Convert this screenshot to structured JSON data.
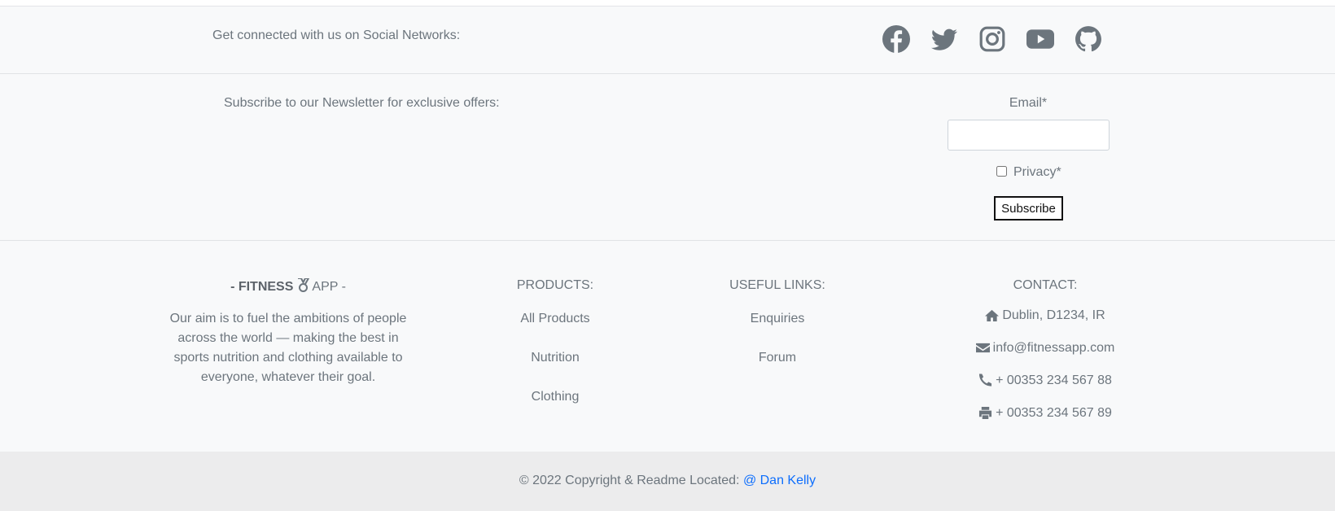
{
  "social": {
    "text": "Get connected with us on Social Networks:",
    "icons": [
      "facebook-icon",
      "twitter-icon",
      "instagram-icon",
      "youtube-icon",
      "github-icon"
    ]
  },
  "newsletter": {
    "text": "Subscribe to our Newsletter for exclusive offers:",
    "email_label": "Email*",
    "email_value": "",
    "privacy_label": "Privacy*",
    "privacy_checked": false,
    "subscribe_label": "Subscribe"
  },
  "brand": {
    "title_left": "- FITNESS",
    "title_icon": "medal-icon",
    "title_right": "APP -",
    "description": "Our aim is to fuel the ambitions of people across the world — making the best in sports nutrition and clothing available to everyone, whatever their goal."
  },
  "products": {
    "heading": "PRODUCTS:",
    "items": [
      "All Products",
      "Nutrition",
      "Clothing"
    ]
  },
  "useful_links": {
    "heading": "USEFUL LINKS:",
    "items": [
      "Enquiries",
      "Forum"
    ]
  },
  "contact": {
    "heading": "CONTACT:",
    "address": "Dublin, D1234, IR",
    "email": "info@fitnessapp.com",
    "phone": "+ 00353 234 567 88",
    "fax": "+ 00353 234 567 89"
  },
  "copyright": {
    "text": "© 2022 Copyright & Readme Located: ",
    "link_label": "@ Dan Kelly"
  },
  "colors": {
    "text": "#6c757d",
    "background": "#f8f9fa",
    "bottom_bar": "#ececed",
    "link": "#0d6efd"
  }
}
